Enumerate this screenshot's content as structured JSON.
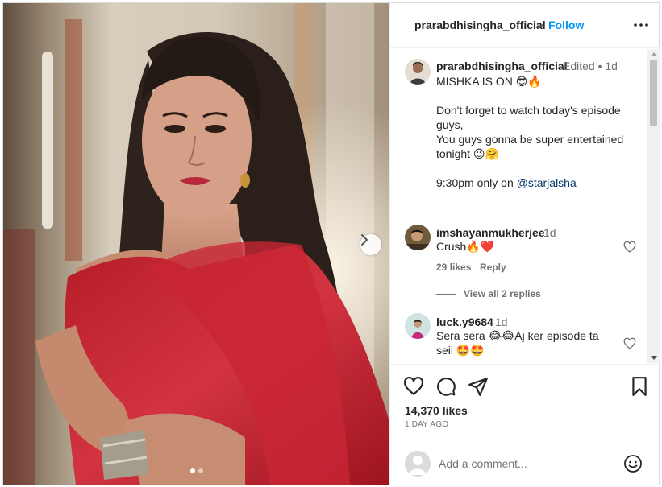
{
  "header": {
    "username": "prarabdhisingha_official",
    "separator": "•",
    "follow_label": "Follow"
  },
  "caption": {
    "username": "prarabdhisingha_official",
    "meta": "Edited • 1d",
    "text": "MISHKA IS ON 😎🔥\n\nDon't forget to watch today's episode guys,\nYou guys gonna be super entertained tonight 😉🤗\n\n9:30pm only on ",
    "mention": "@starjalsha"
  },
  "comments": [
    {
      "username": "imshayanmukherjee",
      "time": "1d",
      "text": "Crush🔥❤️",
      "likes": "29 likes",
      "reply_label": "Reply"
    },
    {
      "username": "luck.y9684",
      "time": "1d",
      "text": "Sera sera 😂😂Aj ker episode ta seii 🤩🤩"
    }
  ],
  "view_replies_label": "View all 2 replies",
  "post": {
    "likes": "14,370 likes",
    "date": "1 DAY AGO"
  },
  "add_comment": {
    "placeholder": "Add a comment..."
  },
  "carousel": {
    "slide_count": 2,
    "active_slide": 1
  },
  "colors": {
    "follow": "#0095f6",
    "mention": "#00376b",
    "muted": "#737373",
    "saree": "#c0252f"
  },
  "icons": [
    "more-options-icon",
    "heart-icon",
    "comment-icon",
    "share-icon",
    "save-icon",
    "emoji-icon",
    "chevron-right-icon"
  ]
}
